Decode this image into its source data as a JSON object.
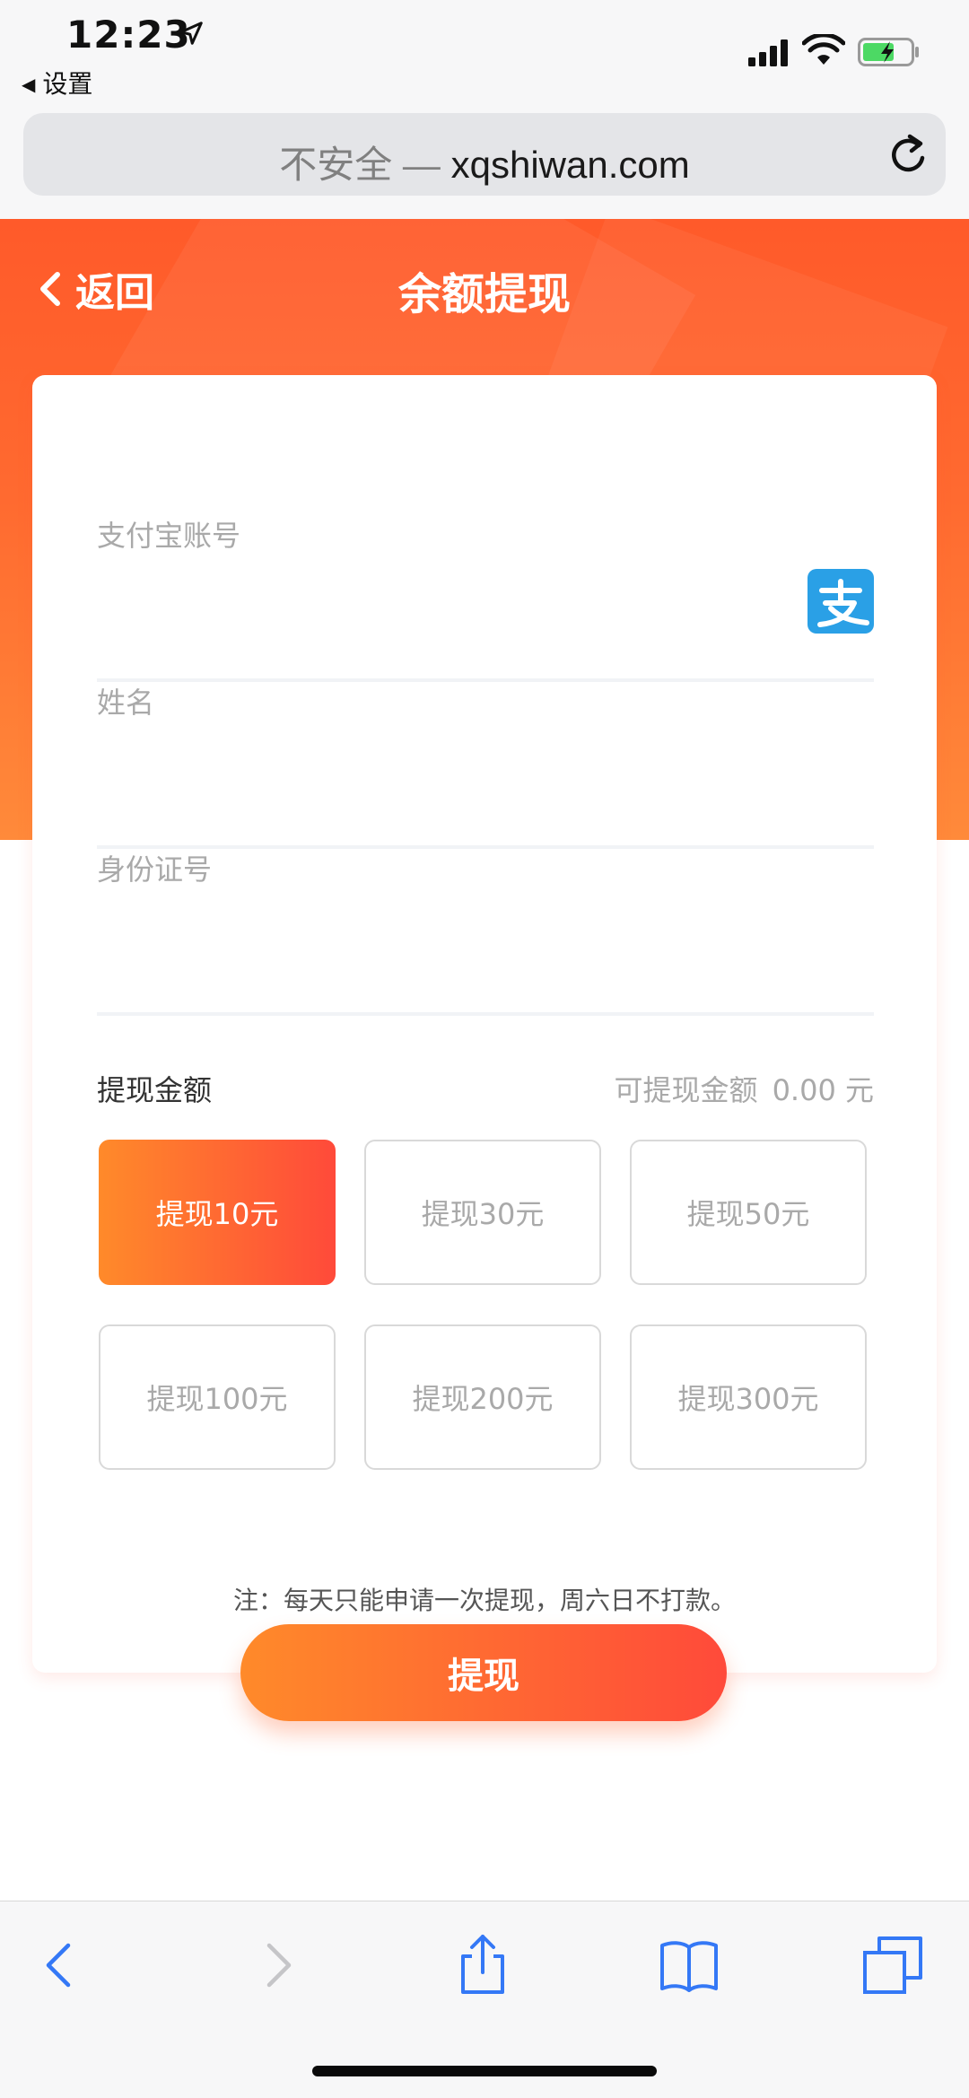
{
  "status_bar": {
    "time": "12:23",
    "back_app": "设置"
  },
  "browser": {
    "insecure_label": "不安全 —",
    "domain": "xqshiwan.com"
  },
  "header": {
    "back_label": "返回",
    "title": "余额提现"
  },
  "form": {
    "alipay_label": "支付宝账号",
    "name_label": "姓名",
    "id_label": "身份证号"
  },
  "amount": {
    "label": "提现金额",
    "available_label": "可提现金额",
    "available_value": "0.00 元",
    "options": [
      {
        "label": "提现10元",
        "selected": true
      },
      {
        "label": "提现30元",
        "selected": false
      },
      {
        "label": "提现50元",
        "selected": false
      },
      {
        "label": "提现100元",
        "selected": false
      },
      {
        "label": "提现200元",
        "selected": false
      },
      {
        "label": "提现300元",
        "selected": false
      }
    ]
  },
  "note": "注：每天只能申请一次提现，周六日不打款。",
  "submit_label": "提现",
  "colors": {
    "brand_orange": "#ff5a2a",
    "gradient_start": "#ff8a2a",
    "gradient_end": "#ff4a3a",
    "alipay_blue": "#2aa0e6",
    "safari_blue": "#3478f6"
  },
  "icons": [
    "location-arrow-icon",
    "signal-icon",
    "wifi-icon",
    "battery-icon",
    "reload-icon",
    "chevron-left-icon",
    "alipay-icon",
    "back-icon",
    "forward-icon",
    "share-icon",
    "bookmarks-icon",
    "tabs-icon"
  ]
}
